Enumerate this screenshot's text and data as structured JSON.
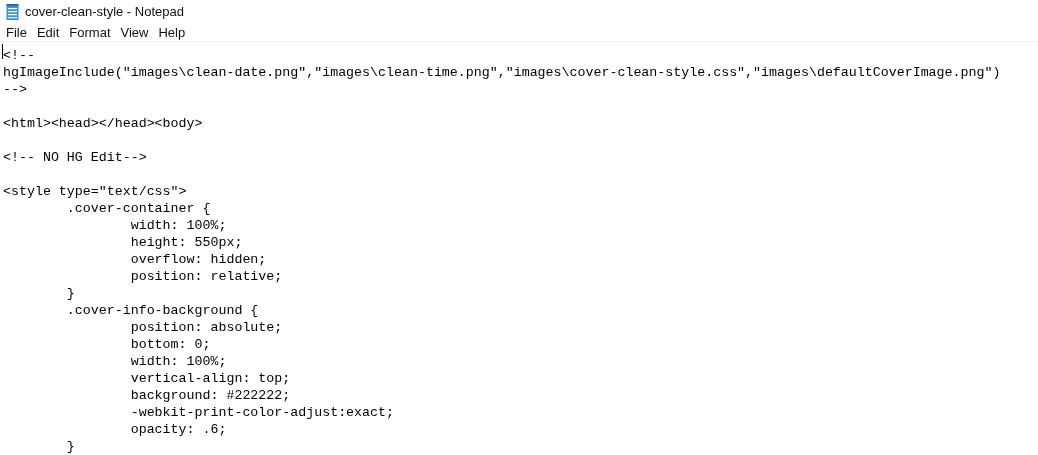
{
  "window": {
    "title": "cover-clean-style - Notepad"
  },
  "menu": [
    "File",
    "Edit",
    "Format",
    "View",
    "Help"
  ],
  "editor": {
    "lines": [
      {
        "text": "<!--",
        "blank_before": false
      },
      {
        "text": "hgImageInclude(\"images\\clean-date.png\",\"images\\clean-time.png\",\"images\\cover-clean-style.css\",\"images\\defaultCoverImage.png\")",
        "blank_before": false
      },
      {
        "text": "-->",
        "blank_before": false
      },
      {
        "text": "<html><head></head><body>",
        "blank_before": true
      },
      {
        "text": "<!-- NO HG Edit-->",
        "blank_before": true
      },
      {
        "text": "<style type=\"text/css\">",
        "blank_before": true
      },
      {
        "text": "        .cover-container {",
        "blank_before": false
      },
      {
        "text": "                width: 100%;",
        "blank_before": false
      },
      {
        "text": "                height: 550px;",
        "blank_before": false
      },
      {
        "text": "                overflow: hidden;",
        "blank_before": false
      },
      {
        "text": "                position: relative;",
        "blank_before": false
      },
      {
        "text": "        }",
        "blank_before": false
      },
      {
        "text": "        .cover-info-background {",
        "blank_before": false
      },
      {
        "text": "                position: absolute;",
        "blank_before": false
      },
      {
        "text": "                bottom: 0;",
        "blank_before": false
      },
      {
        "text": "                width: 100%;",
        "blank_before": false
      },
      {
        "text": "                vertical-align: top;",
        "blank_before": false
      },
      {
        "text": "                background: #222222;",
        "blank_before": false
      },
      {
        "text": "                -webkit-print-color-adjust:exact;",
        "blank_before": false
      },
      {
        "text": "                opacity: .6;",
        "blank_before": false
      },
      {
        "text": "        }",
        "blank_before": false
      }
    ]
  }
}
